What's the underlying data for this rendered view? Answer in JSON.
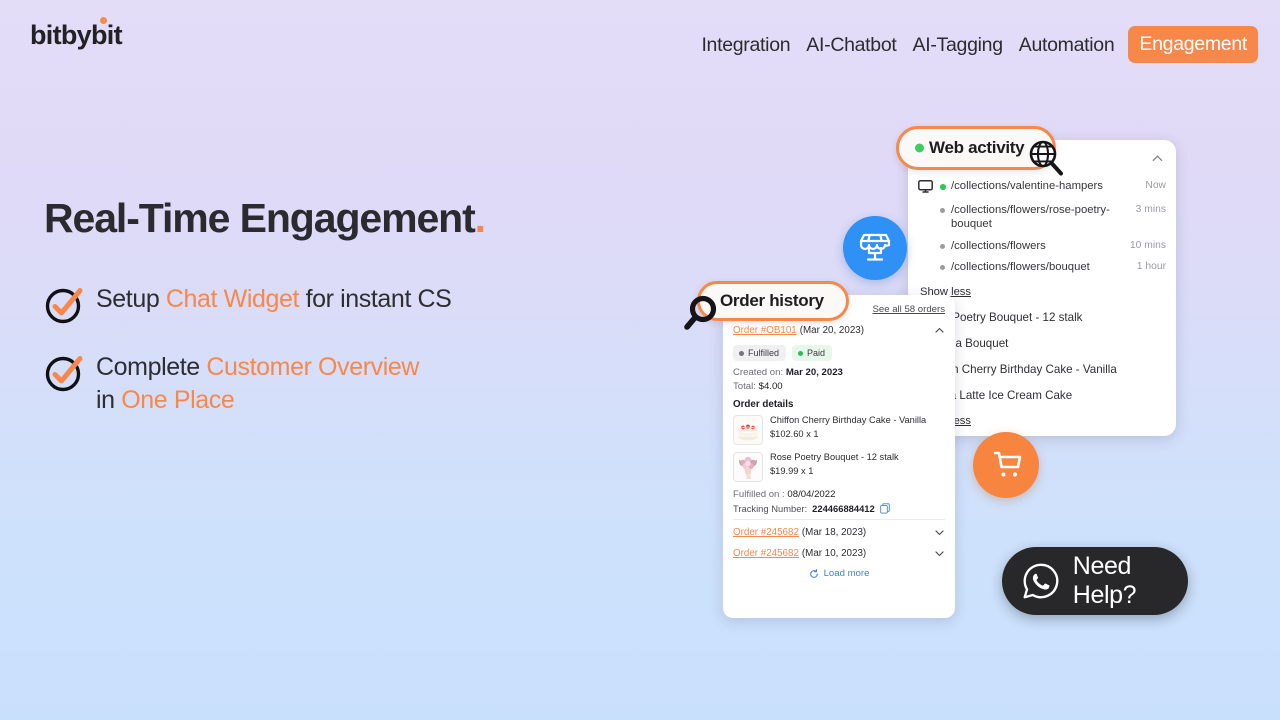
{
  "brand": {
    "part1": "bit",
    "part2": "by",
    "part3": "bit",
    "accent_color": "#f7884a"
  },
  "nav": {
    "items": [
      {
        "label": "Integration",
        "active": false
      },
      {
        "label": "AI-Chatbot",
        "active": false
      },
      {
        "label": "AI-Tagging",
        "active": false
      },
      {
        "label": "Automation",
        "active": false
      },
      {
        "label": "Engagement",
        "active": true
      }
    ]
  },
  "hero": {
    "headline_main": "Real-Time Engagement",
    "headline_dot": ".",
    "bullets": [
      {
        "pre": "Setup ",
        "highlight": "Chat Widget",
        "post": " for instant CS",
        "line2_pre": "",
        "line2_highlight": "",
        "line2_post": ""
      },
      {
        "pre": "Complete ",
        "highlight": "Customer Overview",
        "post": "",
        "line2_pre": "in ",
        "line2_highlight": "One Place",
        "line2_post": ""
      }
    ]
  },
  "web_activity": {
    "callout_label": "Web activity",
    "globe_icon": "globe-search-icon",
    "collapse_icon": "chevron-up-icon",
    "rows": [
      {
        "url": "/collections/valentine-hampers",
        "time": "Now",
        "device_icon": "desktop-monitor-icon",
        "status": "active"
      },
      {
        "url": "/collections/flowers/rose-poetry-bouquet",
        "time": "3 mins",
        "device_icon": "",
        "status": "idle"
      },
      {
        "url": "/collections/flowers",
        "time": "10 mins",
        "device_icon": "",
        "status": "idle"
      },
      {
        "url": "/collections/flowers/bouquet",
        "time": "1 hour",
        "device_icon": "",
        "status": "idle"
      }
    ],
    "show_less_1": "Show less",
    "products": [
      "Rose Poetry Bouquet - 12 stalk",
      "Ophelia Bouquet",
      "Chiffon Cherry Birthday Cake - Vanilla",
      "Mocca Latte Ice Cream Cake"
    ],
    "show_less_2": "Show less"
  },
  "order_history": {
    "callout_label": "Order history",
    "magnifier_icon": "magnifying-glass-icon",
    "see_all": "See all 58 orders",
    "expanded_order": {
      "id": "Order #OB101",
      "date": "(Mar 20, 2023)",
      "collapse_icon": "chevron-up-icon",
      "badges": [
        {
          "label": "Fulfilled",
          "color": "#73737c"
        },
        {
          "label": "Paid",
          "color": "#2bbd52"
        }
      ],
      "created_label": "Created on:",
      "created_value": "Mar 20, 2023",
      "total_label": "Total:",
      "total_value": "$4.00",
      "details_title": "Order details",
      "items": [
        {
          "name": "Chiffon Cherry Birthday Cake - Vanilla",
          "price": "$102.60 x 1",
          "thumb": "birthday-cake-photo"
        },
        {
          "name": "Rose Poetry Bouquet - 12 stalk",
          "price": "$19.99 x 1",
          "thumb": "flower-bouquet-photo"
        }
      ],
      "fulfilled_label": "Fulfilled on :",
      "fulfilled_value": "08/04/2022",
      "tracking_label": "Tracking Number:",
      "tracking_value": "224466884412",
      "copy_icon": "copy-icon"
    },
    "collapsed_orders": [
      {
        "id": "Order #245682",
        "date": "(Mar 18, 2023)",
        "expand_icon": "chevron-down-icon"
      },
      {
        "id": "Order #245682",
        "date": "(Mar 10, 2023)",
        "expand_icon": "chevron-down-icon"
      }
    ],
    "load_more": "Load more",
    "load_more_icon": "refresh-icon"
  },
  "fabs": {
    "store": {
      "icon": "storefront-icon",
      "color": "#2f90f5"
    },
    "cart": {
      "icon": "shopping-cart-icon",
      "color": "#f7853f"
    }
  },
  "need_help": {
    "label": "Need Help?",
    "icon": "whatsapp-icon",
    "color": "#28282a"
  }
}
